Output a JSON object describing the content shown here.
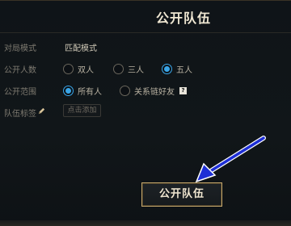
{
  "dialog": {
    "title": "公开队伍"
  },
  "mode": {
    "label": "对局模式",
    "value": "匹配模式"
  },
  "public_count": {
    "label": "公开人数",
    "options": [
      {
        "label": "双人",
        "checked": false
      },
      {
        "label": "三人",
        "checked": false
      },
      {
        "label": "五人",
        "checked": true
      }
    ]
  },
  "public_scope": {
    "label": "公开范围",
    "options": [
      {
        "label": "所有人",
        "checked": true
      },
      {
        "label": "关系链好友",
        "checked": false
      }
    ],
    "help": "?"
  },
  "team_tags": {
    "label": "队伍标签",
    "add_button": "点击添加"
  },
  "publish_button": {
    "label": "公开队伍"
  },
  "colors": {
    "accent_gold": "#c8aa6e",
    "radio_blue": "#3aa6e8",
    "arrow_blue": "#1e2fd6"
  }
}
